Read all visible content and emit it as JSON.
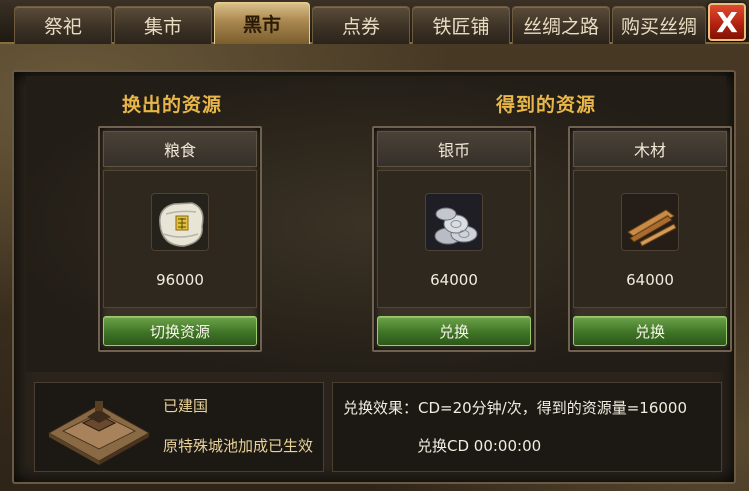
{
  "tabs": [
    {
      "label": "祭祀",
      "active": false
    },
    {
      "label": "集市",
      "active": false
    },
    {
      "label": "黑市",
      "active": true
    },
    {
      "label": "点券",
      "active": false
    },
    {
      "label": "铁匠铺",
      "active": false
    },
    {
      "label": "丝绸之路",
      "active": false
    },
    {
      "label": "购买丝绸",
      "active": false
    }
  ],
  "close_label": "X",
  "headings": {
    "give": "换出的资源",
    "get": "得到的资源"
  },
  "cards": [
    {
      "title": "粮食",
      "amount": "96000",
      "button": "切换资源",
      "icon": "grain-sack-icon"
    },
    {
      "title": "银币",
      "amount": "64000",
      "button": "兑换",
      "icon": "silver-coins-icon"
    },
    {
      "title": "木材",
      "amount": "64000",
      "button": "兑换",
      "icon": "wood-planks-icon"
    }
  ],
  "nation": {
    "status": "已建国",
    "effect": "原特殊城池加成已生效"
  },
  "exchange": {
    "effect": "兑换效果：CD=20分钟/次，得到的资源量=16000",
    "cd": "兑换CD 00:00:00"
  },
  "colors": {
    "heading": "#e8b649",
    "button_green": "#3f7426",
    "active_tab": "#c9a767",
    "close_red": "#c0281a"
  }
}
